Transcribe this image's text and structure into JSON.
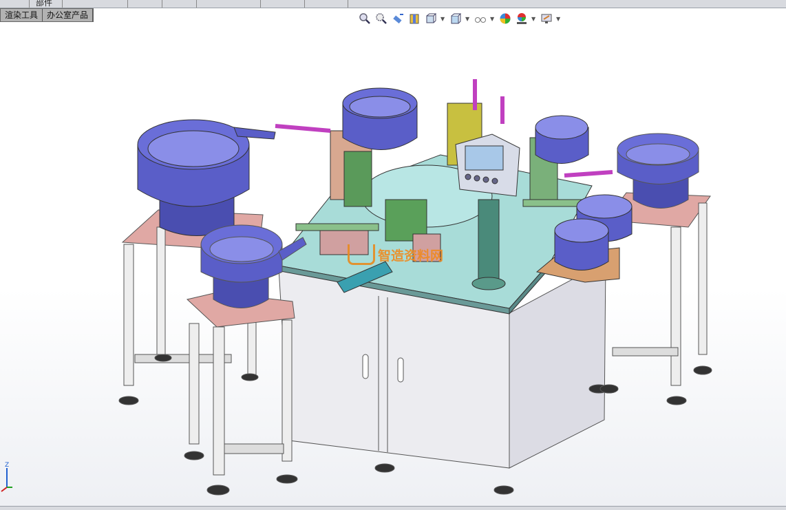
{
  "top_tab": "部件",
  "command_tabs": [
    "渲染工具",
    "办公室产品"
  ],
  "heads_up_toolbar": [
    {
      "icon": "zoom-to-fit-icon",
      "dropdown": false
    },
    {
      "icon": "zoom-to-area-icon",
      "dropdown": false
    },
    {
      "icon": "previous-view-icon",
      "dropdown": false
    },
    {
      "icon": "section-view-icon",
      "dropdown": false
    },
    {
      "icon": "view-orientation-icon",
      "dropdown": true
    },
    {
      "icon": "display-style-icon",
      "dropdown": true
    },
    {
      "icon": "hide-show-items-icon",
      "dropdown": true
    },
    {
      "icon": "edit-appearance-icon",
      "dropdown": false
    },
    {
      "icon": "apply-scene-icon",
      "dropdown": true
    },
    {
      "icon": "view-settings-icon",
      "dropdown": true
    }
  ],
  "watermark": "智造资料网",
  "triad_label": "Z",
  "colors": {
    "bowl": "#5a5ec8",
    "table_top": "#a8dcd8",
    "cabinet": "#ececf0",
    "stand_top": "#e0a8a4"
  }
}
